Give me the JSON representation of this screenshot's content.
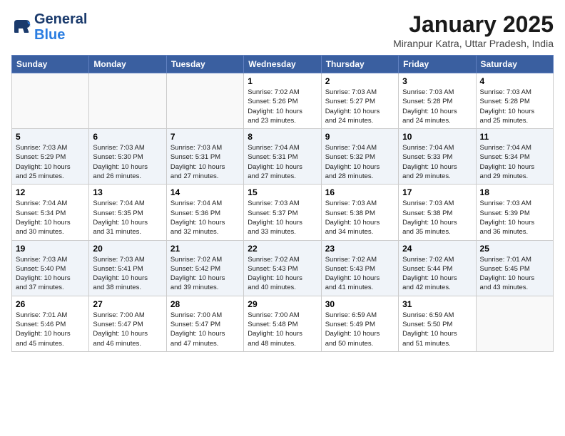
{
  "logo": {
    "line1": "General",
    "line2": "Blue"
  },
  "title": "January 2025",
  "location": "Miranpur Katra, Uttar Pradesh, India",
  "days_header": [
    "Sunday",
    "Monday",
    "Tuesday",
    "Wednesday",
    "Thursday",
    "Friday",
    "Saturday"
  ],
  "weeks": [
    [
      {
        "day": "",
        "info": ""
      },
      {
        "day": "",
        "info": ""
      },
      {
        "day": "",
        "info": ""
      },
      {
        "day": "1",
        "info": "Sunrise: 7:02 AM\nSunset: 5:26 PM\nDaylight: 10 hours\nand 23 minutes."
      },
      {
        "day": "2",
        "info": "Sunrise: 7:03 AM\nSunset: 5:27 PM\nDaylight: 10 hours\nand 24 minutes."
      },
      {
        "day": "3",
        "info": "Sunrise: 7:03 AM\nSunset: 5:28 PM\nDaylight: 10 hours\nand 24 minutes."
      },
      {
        "day": "4",
        "info": "Sunrise: 7:03 AM\nSunset: 5:28 PM\nDaylight: 10 hours\nand 25 minutes."
      }
    ],
    [
      {
        "day": "5",
        "info": "Sunrise: 7:03 AM\nSunset: 5:29 PM\nDaylight: 10 hours\nand 25 minutes."
      },
      {
        "day": "6",
        "info": "Sunrise: 7:03 AM\nSunset: 5:30 PM\nDaylight: 10 hours\nand 26 minutes."
      },
      {
        "day": "7",
        "info": "Sunrise: 7:03 AM\nSunset: 5:31 PM\nDaylight: 10 hours\nand 27 minutes."
      },
      {
        "day": "8",
        "info": "Sunrise: 7:04 AM\nSunset: 5:31 PM\nDaylight: 10 hours\nand 27 minutes."
      },
      {
        "day": "9",
        "info": "Sunrise: 7:04 AM\nSunset: 5:32 PM\nDaylight: 10 hours\nand 28 minutes."
      },
      {
        "day": "10",
        "info": "Sunrise: 7:04 AM\nSunset: 5:33 PM\nDaylight: 10 hours\nand 29 minutes."
      },
      {
        "day": "11",
        "info": "Sunrise: 7:04 AM\nSunset: 5:34 PM\nDaylight: 10 hours\nand 29 minutes."
      }
    ],
    [
      {
        "day": "12",
        "info": "Sunrise: 7:04 AM\nSunset: 5:34 PM\nDaylight: 10 hours\nand 30 minutes."
      },
      {
        "day": "13",
        "info": "Sunrise: 7:04 AM\nSunset: 5:35 PM\nDaylight: 10 hours\nand 31 minutes."
      },
      {
        "day": "14",
        "info": "Sunrise: 7:04 AM\nSunset: 5:36 PM\nDaylight: 10 hours\nand 32 minutes."
      },
      {
        "day": "15",
        "info": "Sunrise: 7:03 AM\nSunset: 5:37 PM\nDaylight: 10 hours\nand 33 minutes."
      },
      {
        "day": "16",
        "info": "Sunrise: 7:03 AM\nSunset: 5:38 PM\nDaylight: 10 hours\nand 34 minutes."
      },
      {
        "day": "17",
        "info": "Sunrise: 7:03 AM\nSunset: 5:38 PM\nDaylight: 10 hours\nand 35 minutes."
      },
      {
        "day": "18",
        "info": "Sunrise: 7:03 AM\nSunset: 5:39 PM\nDaylight: 10 hours\nand 36 minutes."
      }
    ],
    [
      {
        "day": "19",
        "info": "Sunrise: 7:03 AM\nSunset: 5:40 PM\nDaylight: 10 hours\nand 37 minutes."
      },
      {
        "day": "20",
        "info": "Sunrise: 7:03 AM\nSunset: 5:41 PM\nDaylight: 10 hours\nand 38 minutes."
      },
      {
        "day": "21",
        "info": "Sunrise: 7:02 AM\nSunset: 5:42 PM\nDaylight: 10 hours\nand 39 minutes."
      },
      {
        "day": "22",
        "info": "Sunrise: 7:02 AM\nSunset: 5:43 PM\nDaylight: 10 hours\nand 40 minutes."
      },
      {
        "day": "23",
        "info": "Sunrise: 7:02 AM\nSunset: 5:43 PM\nDaylight: 10 hours\nand 41 minutes."
      },
      {
        "day": "24",
        "info": "Sunrise: 7:02 AM\nSunset: 5:44 PM\nDaylight: 10 hours\nand 42 minutes."
      },
      {
        "day": "25",
        "info": "Sunrise: 7:01 AM\nSunset: 5:45 PM\nDaylight: 10 hours\nand 43 minutes."
      }
    ],
    [
      {
        "day": "26",
        "info": "Sunrise: 7:01 AM\nSunset: 5:46 PM\nDaylight: 10 hours\nand 45 minutes."
      },
      {
        "day": "27",
        "info": "Sunrise: 7:00 AM\nSunset: 5:47 PM\nDaylight: 10 hours\nand 46 minutes."
      },
      {
        "day": "28",
        "info": "Sunrise: 7:00 AM\nSunset: 5:47 PM\nDaylight: 10 hours\nand 47 minutes."
      },
      {
        "day": "29",
        "info": "Sunrise: 7:00 AM\nSunset: 5:48 PM\nDaylight: 10 hours\nand 48 minutes."
      },
      {
        "day": "30",
        "info": "Sunrise: 6:59 AM\nSunset: 5:49 PM\nDaylight: 10 hours\nand 50 minutes."
      },
      {
        "day": "31",
        "info": "Sunrise: 6:59 AM\nSunset: 5:50 PM\nDaylight: 10 hours\nand 51 minutes."
      },
      {
        "day": "",
        "info": ""
      }
    ]
  ]
}
